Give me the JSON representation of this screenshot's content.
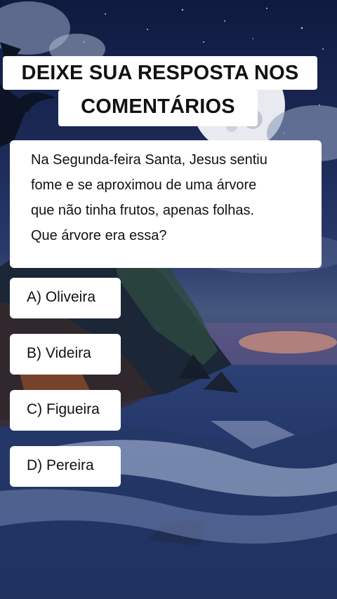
{
  "title": {
    "line1": "DEIXE SUA RESPOSTA NOS",
    "line2": "COMENTÁRIOS"
  },
  "question": {
    "lines": [
      "Na Segunda-feira Santa, Jesus sentiu",
      "fome e se aproximou de uma árvore",
      "que não tinha frutos, apenas folhas.",
      "Que árvore era essa?"
    ]
  },
  "options": [
    {
      "label": "A) Oliveira"
    },
    {
      "label": "B) Videira"
    },
    {
      "label": "C) Figueira"
    },
    {
      "label": "D) Pereira"
    }
  ],
  "colors": {
    "card_background": "#ffffff",
    "text": "#111111",
    "sky_dark": "#0f1a3f",
    "sea": "#2a3f73"
  }
}
